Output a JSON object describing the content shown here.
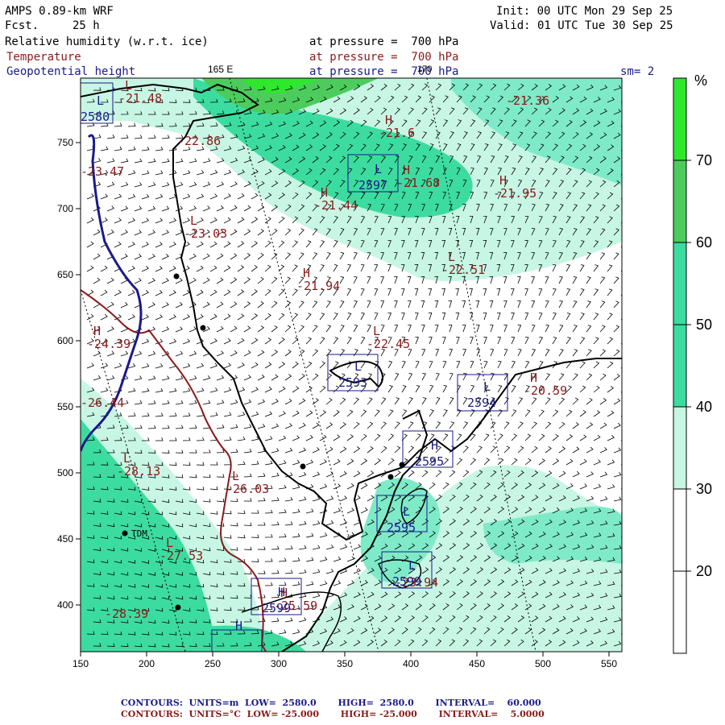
{
  "header": {
    "model": "AMPS 0.89-km WRF",
    "fcst_label": "Fcst.",
    "fcst_value": "25 h",
    "init": "Init: 00 UTC Mon 29 Sep 25",
    "valid": "Valid: 01 UTC Tue 30 Sep 25",
    "field1": "Relative humidity (w.r.t. ice)",
    "field2": "Temperature",
    "field3": "Geopotential height",
    "pressure1": "at pressure =  700 hPa",
    "pressure2": "at pressure =  700 hPa",
    "pressure3": "at pressure =  700 hPa",
    "lon_label1": "165 E",
    "lon_label2": "170",
    "smoothing": "sm= 2"
  },
  "colors": {
    "temperature": "#8b1a1a",
    "height": "#1a1a8b",
    "rh_30": "#c8f6e4",
    "rh_40": "#7eeac8",
    "rh_50": "#3cdca0",
    "rh_60": "#4ccc5c",
    "rh_70": "#2ee82e"
  },
  "colorbar": {
    "unit": "%",
    "labels": [
      "70",
      "60",
      "50",
      "40",
      "30",
      "20"
    ],
    "bins": [
      {
        "min": 70,
        "color": "#2ee82e"
      },
      {
        "min": 60,
        "color": "#4ccc5c"
      },
      {
        "min": 50,
        "color": "#3cdca0"
      },
      {
        "min": 40,
        "color": "#3cdca0"
      },
      {
        "min": 30,
        "color": "#c8f6e4"
      },
      {
        "min": 20,
        "color": "#ffffff"
      },
      {
        "min": 10,
        "color": "#ffffff"
      }
    ]
  },
  "axes": {
    "x_ticks": [
      "150",
      "200",
      "250",
      "300",
      "350",
      "400",
      "450",
      "500",
      "550"
    ],
    "y_ticks": [
      "750",
      "700",
      "650",
      "600",
      "550",
      "500",
      "450",
      "400"
    ]
  },
  "temperature_labels": [
    {
      "mark": "L",
      "value": "-21.48"
    },
    {
      "mark": "",
      "value": "-22.86"
    },
    {
      "mark": "H",
      "value": "-21.6"
    },
    {
      "mark": "",
      "value": "-21.36"
    },
    {
      "mark": "",
      "value": "-23.47"
    },
    {
      "mark": "H",
      "value": "-21.68"
    },
    {
      "mark": "H",
      "value": "-21.44"
    },
    {
      "mark": "H",
      "value": "-21.95"
    },
    {
      "mark": "L",
      "value": "-23.03"
    },
    {
      "mark": "L",
      "value": "-22.51"
    },
    {
      "mark": "H",
      "value": "-21.94"
    },
    {
      "mark": "L",
      "value": "-22.45"
    },
    {
      "mark": "H",
      "value": "-24.39"
    },
    {
      "mark": "H",
      "value": "-20.59"
    },
    {
      "mark": "",
      "value": "-26.44"
    },
    {
      "mark": "L",
      "value": "-28.13"
    },
    {
      "mark": "L",
      "value": "-26.03"
    },
    {
      "mark": "L",
      "value": "-27.53"
    },
    {
      "mark": "",
      "value": "-28.39"
    },
    {
      "mark": "H",
      "value": "-25.59"
    },
    {
      "mark": "",
      "value": "-23.94"
    }
  ],
  "height_labels": [
    {
      "mark": "L",
      "value": "2580"
    },
    {
      "mark": "L",
      "value": "2597"
    },
    {
      "mark": "L",
      "value": "2593"
    },
    {
      "mark": "L",
      "value": "2594"
    },
    {
      "mark": "H",
      "value": "2595"
    },
    {
      "mark": "L",
      "value": "2595"
    },
    {
      "mark": "L",
      "value": "2599"
    },
    {
      "mark": "H",
      "value": "2599"
    },
    {
      "mark": "H",
      "value": ""
    }
  ],
  "station": "TDM",
  "footer": {
    "height_contours": "CONTOURS:  UNITS=m  LOW=  2580.0       HIGH=  2580.0       INTERVAL=    60.000",
    "temp_contours": "CONTOURS:  UNITS=°C  LOW= -25.000       HIGH= -25.000       INTERVAL=    5.0000"
  }
}
